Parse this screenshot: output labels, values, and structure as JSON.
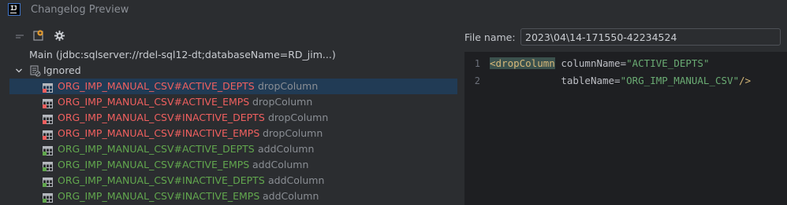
{
  "window": {
    "title": "Changelog Preview",
    "app_badge": "IJ"
  },
  "tree": {
    "root_label": "Main (jdbc:sqlserver://rdel-sql12-dt;databaseName=RD_jim...)",
    "group_label": "Ignored",
    "items": [
      {
        "name": "ORG_IMP_MANUAL_CSV#ACTIVE_DEPTS",
        "action": "dropColumn",
        "kind": "drop",
        "selected": true
      },
      {
        "name": "ORG_IMP_MANUAL_CSV#ACTIVE_EMPS",
        "action": "dropColumn",
        "kind": "drop"
      },
      {
        "name": "ORG_IMP_MANUAL_CSV#INACTIVE_DEPTS",
        "action": "dropColumn",
        "kind": "drop"
      },
      {
        "name": "ORG_IMP_MANUAL_CSV#INACTIVE_EMPS",
        "action": "dropColumn",
        "kind": "drop"
      },
      {
        "name": "ORG_IMP_MANUAL_CSV#ACTIVE_DEPTS",
        "action": "addColumn",
        "kind": "add"
      },
      {
        "name": "ORG_IMP_MANUAL_CSV#ACTIVE_EMPS",
        "action": "addColumn",
        "kind": "add"
      },
      {
        "name": "ORG_IMP_MANUAL_CSV#INACTIVE_DEPTS",
        "action": "addColumn",
        "kind": "add"
      },
      {
        "name": "ORG_IMP_MANUAL_CSV#INACTIVE_EMPS",
        "action": "addColumn",
        "kind": "add"
      }
    ]
  },
  "file": {
    "label": "File name:",
    "value": "2023\\04\\14-171550-42234524"
  },
  "editor": {
    "line_numbers": [
      "1",
      "2"
    ],
    "line1": {
      "open": "<dropColumn",
      "attr": " columnName=",
      "value": "\"ACTIVE_DEPTS\""
    },
    "line2": {
      "indent": "            ",
      "attr": "tableName=",
      "value": "\"ORG_IMP_MANUAL_CSV\"",
      "close": "/>"
    }
  },
  "colors": {
    "drop": "#f0605f",
    "add": "#62a74e",
    "selection": "#213b55"
  }
}
